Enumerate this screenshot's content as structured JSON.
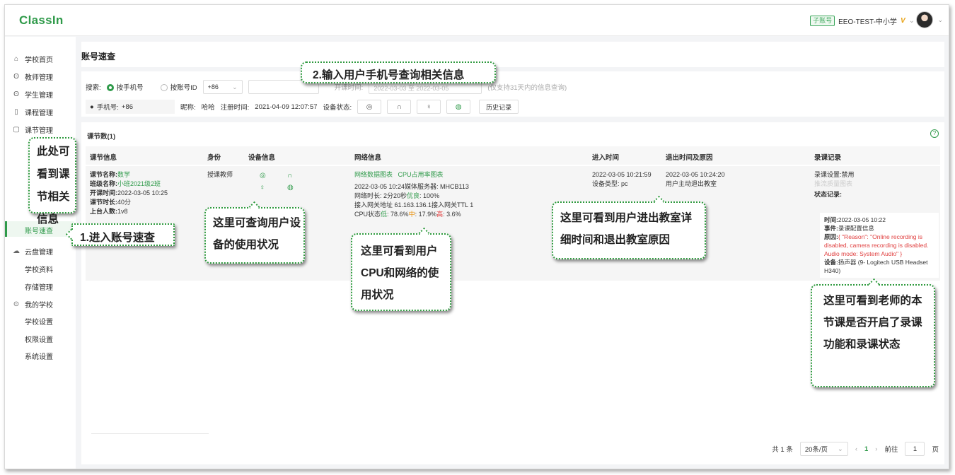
{
  "app": {
    "logo": "ClassIn"
  },
  "account": {
    "badge": "子账号",
    "name": "EEO-TEST-中小学",
    "vip": "V",
    "caret": "⌄"
  },
  "sidebar": {
    "items": [
      {
        "label": "学校首页",
        "icon": "home-icon",
        "glyph": "⌂"
      },
      {
        "label": "教师管理",
        "icon": "teacher-icon",
        "glyph": "ʘ"
      },
      {
        "label": "学生管理",
        "icon": "student-icon",
        "glyph": "ʘ"
      },
      {
        "label": "课程管理",
        "icon": "course-icon",
        "glyph": "▯"
      },
      {
        "label": "课节管理",
        "icon": "lesson-icon",
        "glyph": "▢"
      },
      {
        "label": "账号速查",
        "active": true
      },
      {
        "label": "云盘管理",
        "icon": "cloud-icon",
        "glyph": "☁"
      },
      {
        "label": "学校资料"
      },
      {
        "label": "存储管理"
      },
      {
        "label": "我的学校",
        "icon": "school-icon",
        "glyph": "⊙"
      },
      {
        "label": "学校设置"
      },
      {
        "label": "权限设置"
      },
      {
        "label": "系统设置"
      }
    ]
  },
  "page": {
    "title": "账号速查"
  },
  "search": {
    "label": "搜索:",
    "option_phone": "按手机号",
    "option_id": "按账号ID",
    "country_code": "+86",
    "caret": "⌄",
    "time_label": "开课时间:",
    "date_range": "2022-03-03 至 2022-03-05",
    "hint": "(仅支持31天内的信息查询)",
    "info": {
      "phone_label": "手机号:",
      "phone_value": "+86",
      "nickname_label": "昵称:",
      "nickname_value": "哈哈",
      "register_label": "注册时间:",
      "register_value": "2021-04-09 12:07:57",
      "device_status_label": "设备状态:"
    },
    "device_buttons": [
      {
        "name": "camera",
        "glyph": "◎"
      },
      {
        "name": "headset",
        "glyph": "∩"
      },
      {
        "name": "microphone",
        "glyph": "♀"
      },
      {
        "name": "network",
        "glyph": "◍"
      }
    ],
    "history_button": "历史记录"
  },
  "results": {
    "count_label": "课节数(1)",
    "help_glyph": "?",
    "columns": [
      "课节信息",
      "身份",
      "设备信息",
      "网络信息",
      "进入时间",
      "退出时间及原因",
      "录课记录"
    ],
    "row": {
      "lesson_name_label": "课节名称:",
      "lesson_name": "数学",
      "class_name_label": "班级名称:",
      "class_name": "小班2021级2班",
      "start_label": "开课时间:",
      "start_time": "2022-03-05 10:25",
      "duration_label": "课节时长:",
      "duration": "40分",
      "stage_label": "上台人数:",
      "stage_count": "1v8",
      "role": "授课教师",
      "device_icons": [
        "◎",
        "∩",
        "♀",
        "◍"
      ],
      "network_chart_link": "网络数据图表",
      "cpu_chart_link": "CPU占用率图表",
      "net_line1": "2022-03-05 10:24媒体服务器: MHCB113",
      "net_line2_prefix": "网络时长: 2分20秒",
      "net_line2_good": "优良",
      "net_line2_suffix": ": 100%",
      "net_line3": "接入网关地址 61.163.136.1接入网关TTL 1",
      "cpu_prefix": "CPU状态",
      "cpu_low_label": "低",
      "cpu_low_value": ": 78.6%",
      "cpu_mid_label": "中",
      "cpu_mid_value": ": 17.9%",
      "cpu_high_label": "高",
      "cpu_high_value": ": 3.6%",
      "enter_time": "2022-03-05 10:21:59",
      "device_type": "设备类型: pc",
      "exit_time": "2022-03-05 10:24:20",
      "exit_reason": "用户主动退出教室",
      "rec_setting": "录课设置:禁用",
      "rec_chart": "推流质量图表",
      "status_title": "状态记录:",
      "rec_time_label": "时间:",
      "rec_time": "2022-03-05 10:22",
      "rec_event_label": "事件:",
      "rec_event": "录课配置信息",
      "rec_reason_label": "原因:",
      "rec_reason": "{ \"Reason\": \"Online recording is disabled, camera recording is disabled. Audio mode: System Audio\" }",
      "rec_device_label": "设备:",
      "rec_device": "扬声器 (9- Logitech USB Headset H340)"
    }
  },
  "pagination": {
    "total": "共 1 条",
    "page_size": "20条/页",
    "caret": "⌄",
    "prev": "‹",
    "current": "1",
    "next": "›",
    "goto_label": "前往",
    "goto_value": "1",
    "goto_suffix": "页"
  },
  "callouts": {
    "c1": "2.输入用户手机号查询相关信息",
    "c2": "此处可看到课节相关信息",
    "c3": "1.进入账号速查",
    "c4": "这里可查询用户设备的使用状况",
    "c5": "这里可看到用户CPU和网络的使用状况",
    "c6": "这里可看到用户进出教室详细时间和退出教室原因",
    "c7": "这里可看到老师的本节课是否开启了录课功能和录课状态"
  },
  "colors": {
    "accent": "#2f9a4a",
    "callout_border": "#2e9a3e",
    "warning": "#e8900c",
    "error": "#e04040"
  }
}
